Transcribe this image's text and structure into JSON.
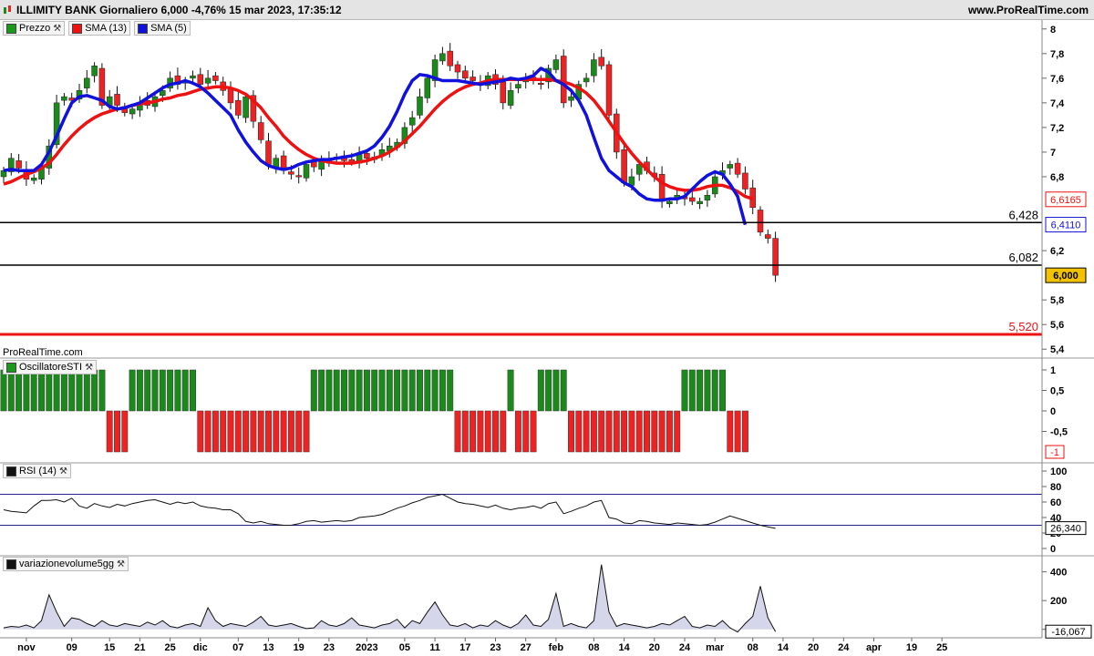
{
  "header": {
    "title": "ILLIMITY BANK Giornaliero 6,000 -4,76% 15 mar 2023, 17:35:12",
    "site": "www.ProRealTime.com",
    "watermark": "ProRealTime.com"
  },
  "legends": {
    "price": [
      {
        "label": "Prezzo",
        "color": "#1a9a1a"
      },
      {
        "label": "SMA (13)",
        "color": "#ee1111"
      },
      {
        "label": "SMA (5)",
        "color": "#1111dd"
      }
    ],
    "osc": {
      "label": "OscillatoreSTI",
      "color": "#1a9a1a"
    },
    "rsi": {
      "label": "RSI (14)",
      "color": "#111111"
    },
    "vol": {
      "label": "variazionevolume5gg",
      "color": "#111111"
    }
  },
  "colors": {
    "up": "#1a8a1a",
    "down": "#ee2222",
    "sma13": "#ee1111",
    "sma5": "#1111dd",
    "vol_fill": "#d6d6ea"
  },
  "chart_data": [
    {
      "type": "candlestick",
      "title": "ILLIMITY BANK Giornaliero",
      "ylim": [
        5.35,
        8.05
      ],
      "yticks": [
        {
          "v": 8,
          "label": "8"
        },
        {
          "v": 7.8,
          "label": "7,8"
        },
        {
          "v": 7.6,
          "label": "7,6"
        },
        {
          "v": 7.4,
          "label": "7,4"
        },
        {
          "v": 7.2,
          "label": "7,2"
        },
        {
          "v": 7,
          "label": "7"
        },
        {
          "v": 6.8,
          "label": "6,8"
        },
        {
          "v": 6.2,
          "label": "6,2"
        },
        {
          "v": 5.8,
          "label": "5,8"
        },
        {
          "v": 5.6,
          "label": "5,6"
        },
        {
          "v": 5.4,
          "label": "5,4"
        }
      ],
      "xlabels": [
        {
          "i": 3,
          "label": "nov"
        },
        {
          "i": 9,
          "label": "09"
        },
        {
          "i": 14,
          "label": "15"
        },
        {
          "i": 18,
          "label": "21"
        },
        {
          "i": 22,
          "label": "25"
        },
        {
          "i": 26,
          "label": "dic"
        },
        {
          "i": 31,
          "label": "07"
        },
        {
          "i": 35,
          "label": "13"
        },
        {
          "i": 39,
          "label": "19"
        },
        {
          "i": 43,
          "label": "23"
        },
        {
          "i": 48,
          "label": "2023"
        },
        {
          "i": 53,
          "label": "05"
        },
        {
          "i": 57,
          "label": "11"
        },
        {
          "i": 61,
          "label": "17"
        },
        {
          "i": 65,
          "label": "23"
        },
        {
          "i": 69,
          "label": "27"
        },
        {
          "i": 73,
          "label": "feb"
        },
        {
          "i": 78,
          "label": "08"
        },
        {
          "i": 82,
          "label": "14"
        },
        {
          "i": 86,
          "label": "20"
        },
        {
          "i": 90,
          "label": "24"
        },
        {
          "i": 94,
          "label": "mar"
        },
        {
          "i": 99,
          "label": "08"
        },
        {
          "i": 103,
          "label": "14"
        },
        {
          "i": 107,
          "label": "20"
        },
        {
          "i": 111,
          "label": "24"
        },
        {
          "i": 115,
          "label": "apr"
        },
        {
          "i": 120,
          "label": "19"
        },
        {
          "i": 124,
          "label": "25"
        }
      ],
      "hlines": [
        {
          "v": 6.428,
          "label": "6,428",
          "color": "#000000"
        },
        {
          "v": 6.082,
          "label": "6,082",
          "color": "#000000"
        },
        {
          "v": 5.52,
          "label": "5,520",
          "color": "#ee1111"
        }
      ],
      "badges": [
        {
          "v": 6.6165,
          "label": "6,6165",
          "color": "#ee1111",
          "bg": "#ffffff"
        },
        {
          "v": 6.411,
          "label": "6,4110",
          "color": "#1111dd",
          "bg": "#ffffff"
        },
        {
          "v": 6.0,
          "label": "6,000",
          "color": "#000000",
          "bg": "#f2c200"
        }
      ],
      "closes": [
        6.85,
        6.95,
        6.87,
        6.78,
        6.79,
        6.88,
        7.05,
        7.4,
        7.45,
        7.42,
        7.5,
        7.6,
        7.7,
        7.38,
        7.45,
        7.38,
        7.32,
        7.35,
        7.4,
        7.38,
        7.45,
        7.5,
        7.6,
        7.55,
        7.58,
        7.62,
        7.55,
        7.6,
        7.58,
        7.5,
        7.4,
        7.3,
        7.45,
        7.25,
        7.1,
        6.9,
        6.95,
        6.85,
        6.82,
        6.8,
        6.9,
        6.88,
        6.92,
        6.94,
        6.96,
        6.93,
        6.92,
        6.98,
        6.95,
        6.96,
        7.02,
        7.05,
        7.08,
        7.2,
        7.28,
        7.45,
        7.6,
        7.75,
        7.8,
        7.7,
        7.65,
        7.6,
        7.58,
        7.55,
        7.62,
        7.55,
        7.4,
        7.5,
        7.55,
        7.6,
        7.58,
        7.55,
        7.68,
        7.75,
        7.4,
        7.45,
        7.55,
        7.6,
        7.75,
        7.7,
        7.3,
        7.0,
        6.75,
        6.8,
        6.9,
        6.85,
        6.8,
        6.6,
        6.6,
        6.65,
        6.62,
        6.6,
        6.6,
        6.65,
        6.8,
        6.85,
        6.9,
        6.82,
        6.7,
        6.55,
        6.35,
        6.3,
        6.0
      ],
      "opens": [
        6.8,
        6.84,
        6.93,
        6.86,
        6.77,
        6.78,
        6.87,
        7.06,
        7.42,
        7.44,
        7.43,
        7.52,
        7.62,
        7.68,
        7.38,
        7.47,
        7.37,
        7.31,
        7.34,
        7.42,
        7.37,
        7.46,
        7.52,
        7.62,
        7.56,
        7.6,
        7.63,
        7.56,
        7.62,
        7.57,
        7.52,
        7.42,
        7.28,
        7.46,
        7.24,
        7.09,
        6.88,
        6.97,
        6.84,
        6.81,
        6.79,
        6.92,
        6.86,
        6.91,
        6.95,
        6.97,
        6.94,
        6.91,
        6.99,
        6.94,
        6.97,
        7.01,
        7.04,
        7.07,
        7.22,
        7.3,
        7.44,
        7.58,
        7.74,
        7.82,
        7.71,
        7.66,
        7.61,
        7.56,
        7.54,
        7.63,
        7.57,
        7.38,
        7.52,
        7.57,
        7.61,
        7.56,
        7.57,
        7.67,
        7.78,
        7.42,
        7.43,
        7.57,
        7.62,
        7.77,
        7.71,
        7.31,
        7.02,
        6.73,
        6.82,
        6.92,
        6.83,
        6.82,
        6.58,
        6.62,
        6.64,
        6.63,
        6.58,
        6.61,
        6.66,
        6.82,
        6.87,
        6.91,
        6.83,
        6.71,
        6.53,
        6.33,
        6.3
      ],
      "sma13": [
        6.74,
        6.76,
        6.79,
        6.82,
        6.84,
        6.87,
        6.91,
        6.98,
        7.06,
        7.13,
        7.19,
        7.24,
        7.28,
        7.31,
        7.33,
        7.35,
        7.36,
        7.38,
        7.39,
        7.4,
        7.41,
        7.43,
        7.44,
        7.46,
        7.47,
        7.49,
        7.51,
        7.52,
        7.53,
        7.53,
        7.52,
        7.5,
        7.47,
        7.42,
        7.36,
        7.28,
        7.21,
        7.13,
        7.07,
        7.02,
        6.98,
        6.95,
        6.93,
        6.92,
        6.91,
        6.91,
        6.91,
        6.92,
        6.93,
        6.95,
        6.97,
        7.0,
        7.04,
        7.09,
        7.15,
        7.21,
        7.28,
        7.35,
        7.41,
        7.46,
        7.5,
        7.53,
        7.55,
        7.56,
        7.58,
        7.59,
        7.59,
        7.59,
        7.59,
        7.59,
        7.59,
        7.59,
        7.59,
        7.58,
        7.57,
        7.55,
        7.52,
        7.48,
        7.42,
        7.34,
        7.25,
        7.16,
        7.07,
        6.99,
        6.92,
        6.86,
        6.8,
        6.75,
        6.72,
        6.7,
        6.69,
        6.69,
        6.7,
        6.72,
        6.73,
        6.73,
        6.71,
        6.68,
        6.64,
        6.62
      ],
      "sma5": [
        6.85,
        6.86,
        6.85,
        6.85,
        6.85,
        6.9,
        7.0,
        7.13,
        7.27,
        7.4,
        7.45,
        7.46,
        7.44,
        7.42,
        7.37,
        7.35,
        7.36,
        7.38,
        7.4,
        7.44,
        7.48,
        7.52,
        7.55,
        7.56,
        7.58,
        7.56,
        7.53,
        7.48,
        7.42,
        7.36,
        7.3,
        7.18,
        7.08,
        7.0,
        6.93,
        6.89,
        6.87,
        6.86,
        6.87,
        6.9,
        6.92,
        6.93,
        6.94,
        6.94,
        6.95,
        6.96,
        6.97,
        6.99,
        7.01,
        7.05,
        7.12,
        7.21,
        7.33,
        7.47,
        7.58,
        7.63,
        7.62,
        7.6,
        7.58,
        7.58,
        7.58,
        7.57,
        7.56,
        7.55,
        7.56,
        7.57,
        7.58,
        7.6,
        7.59,
        7.6,
        7.62,
        7.68,
        7.65,
        7.58,
        7.55,
        7.5,
        7.42,
        7.3,
        7.12,
        6.95,
        6.85,
        6.8,
        6.75,
        6.72,
        6.66,
        6.62,
        6.61,
        6.61,
        6.62,
        6.62,
        6.64,
        6.7,
        6.76,
        6.81,
        6.84,
        6.82,
        6.74,
        6.64,
        6.41
      ]
    },
    {
      "type": "bar",
      "title": "OscillatoreSTI",
      "ylim": [
        -1.2,
        1.2
      ],
      "yticks": [
        {
          "v": 1,
          "label": "1"
        },
        {
          "v": 0.5,
          "label": "0,5"
        },
        {
          "v": 0,
          "label": "0"
        },
        {
          "v": -0.5,
          "label": "-0,5"
        }
      ],
      "badge": {
        "v": -1,
        "label": "-1",
        "color": "#ee1111"
      },
      "values": [
        1,
        1,
        1,
        1,
        1,
        1,
        1,
        1,
        1,
        1,
        1,
        1,
        1,
        1,
        -1,
        -1,
        -1,
        1,
        1,
        1,
        1,
        1,
        1,
        1,
        1,
        1,
        -1,
        -1,
        -1,
        -1,
        -1,
        -1,
        -1,
        -1,
        -1,
        -1,
        -1,
        -1,
        -1,
        -1,
        -1,
        1,
        1,
        1,
        1,
        1,
        1,
        1,
        1,
        1,
        1,
        1,
        1,
        1,
        1,
        1,
        1,
        1,
        1,
        1,
        -1,
        -1,
        -1,
        -1,
        -1,
        -1,
        -1,
        1,
        -1,
        -1,
        -1,
        1,
        1,
        1,
        1,
        -1,
        -1,
        -1,
        -1,
        -1,
        -1,
        -1,
        -1,
        -1,
        -1,
        -1,
        -1,
        -1,
        -1,
        -1,
        1,
        1,
        1,
        1,
        1,
        1,
        -1,
        -1,
        -1
      ]
    },
    {
      "type": "line",
      "title": "RSI (14)",
      "ylim": [
        0,
        100
      ],
      "yticks": [
        {
          "v": 100,
          "label": "100"
        },
        {
          "v": 80,
          "label": "80"
        },
        {
          "v": 60,
          "label": "60"
        },
        {
          "v": 40,
          "label": "40"
        },
        {
          "v": 20,
          "label": "20"
        },
        {
          "v": 0,
          "label": "0"
        }
      ],
      "levels": [
        70,
        30
      ],
      "badge": {
        "v": 26.34,
        "label": "26,340",
        "color": "#000000"
      },
      "values": [
        50,
        48,
        47,
        46,
        55,
        62,
        62,
        63,
        60,
        65,
        55,
        52,
        58,
        55,
        53,
        57,
        55,
        58,
        60,
        62,
        63,
        60,
        57,
        60,
        58,
        60,
        55,
        53,
        52,
        50,
        50,
        45,
        35,
        33,
        35,
        32,
        31,
        30,
        30,
        32,
        35,
        36,
        34,
        35,
        36,
        35,
        36,
        40,
        41,
        42,
        44,
        48,
        52,
        55,
        59,
        62,
        66,
        68,
        70,
        65,
        60,
        58,
        57,
        55,
        53,
        56,
        52,
        50,
        52,
        53,
        55,
        52,
        58,
        60,
        45,
        48,
        52,
        55,
        60,
        62,
        40,
        38,
        33,
        32,
        36,
        35,
        33,
        32,
        31,
        33,
        32,
        31,
        30,
        31,
        34,
        38,
        42,
        39,
        36,
        33,
        30,
        28,
        26
      ]
    },
    {
      "type": "area",
      "title": "variazionevolume5gg",
      "ylim": [
        -40,
        480
      ],
      "yticks": [
        {
          "v": 400,
          "label": "400"
        },
        {
          "v": 200,
          "label": "200"
        },
        {
          "v": 0,
          "label": "0"
        }
      ],
      "badge": {
        "v": -16.067,
        "label": "-16,067",
        "color": "#000000"
      },
      "values": [
        10,
        20,
        15,
        30,
        10,
        60,
        240,
        120,
        20,
        80,
        70,
        40,
        20,
        60,
        30,
        20,
        40,
        30,
        20,
        50,
        30,
        60,
        20,
        10,
        30,
        40,
        20,
        150,
        60,
        20,
        40,
        30,
        20,
        50,
        90,
        30,
        20,
        30,
        40,
        20,
        5,
        10,
        60,
        30,
        20,
        40,
        80,
        30,
        20,
        10,
        30,
        40,
        70,
        10,
        60,
        40,
        120,
        190,
        100,
        30,
        20,
        40,
        10,
        30,
        20,
        60,
        30,
        10,
        40,
        100,
        30,
        20,
        70,
        250,
        20,
        40,
        20,
        10,
        60,
        450,
        120,
        20,
        40,
        30,
        20,
        10,
        20,
        40,
        30,
        60,
        90,
        20,
        10,
        30,
        20,
        60,
        10,
        -20,
        40,
        90,
        300,
        80,
        -16
      ]
    }
  ]
}
